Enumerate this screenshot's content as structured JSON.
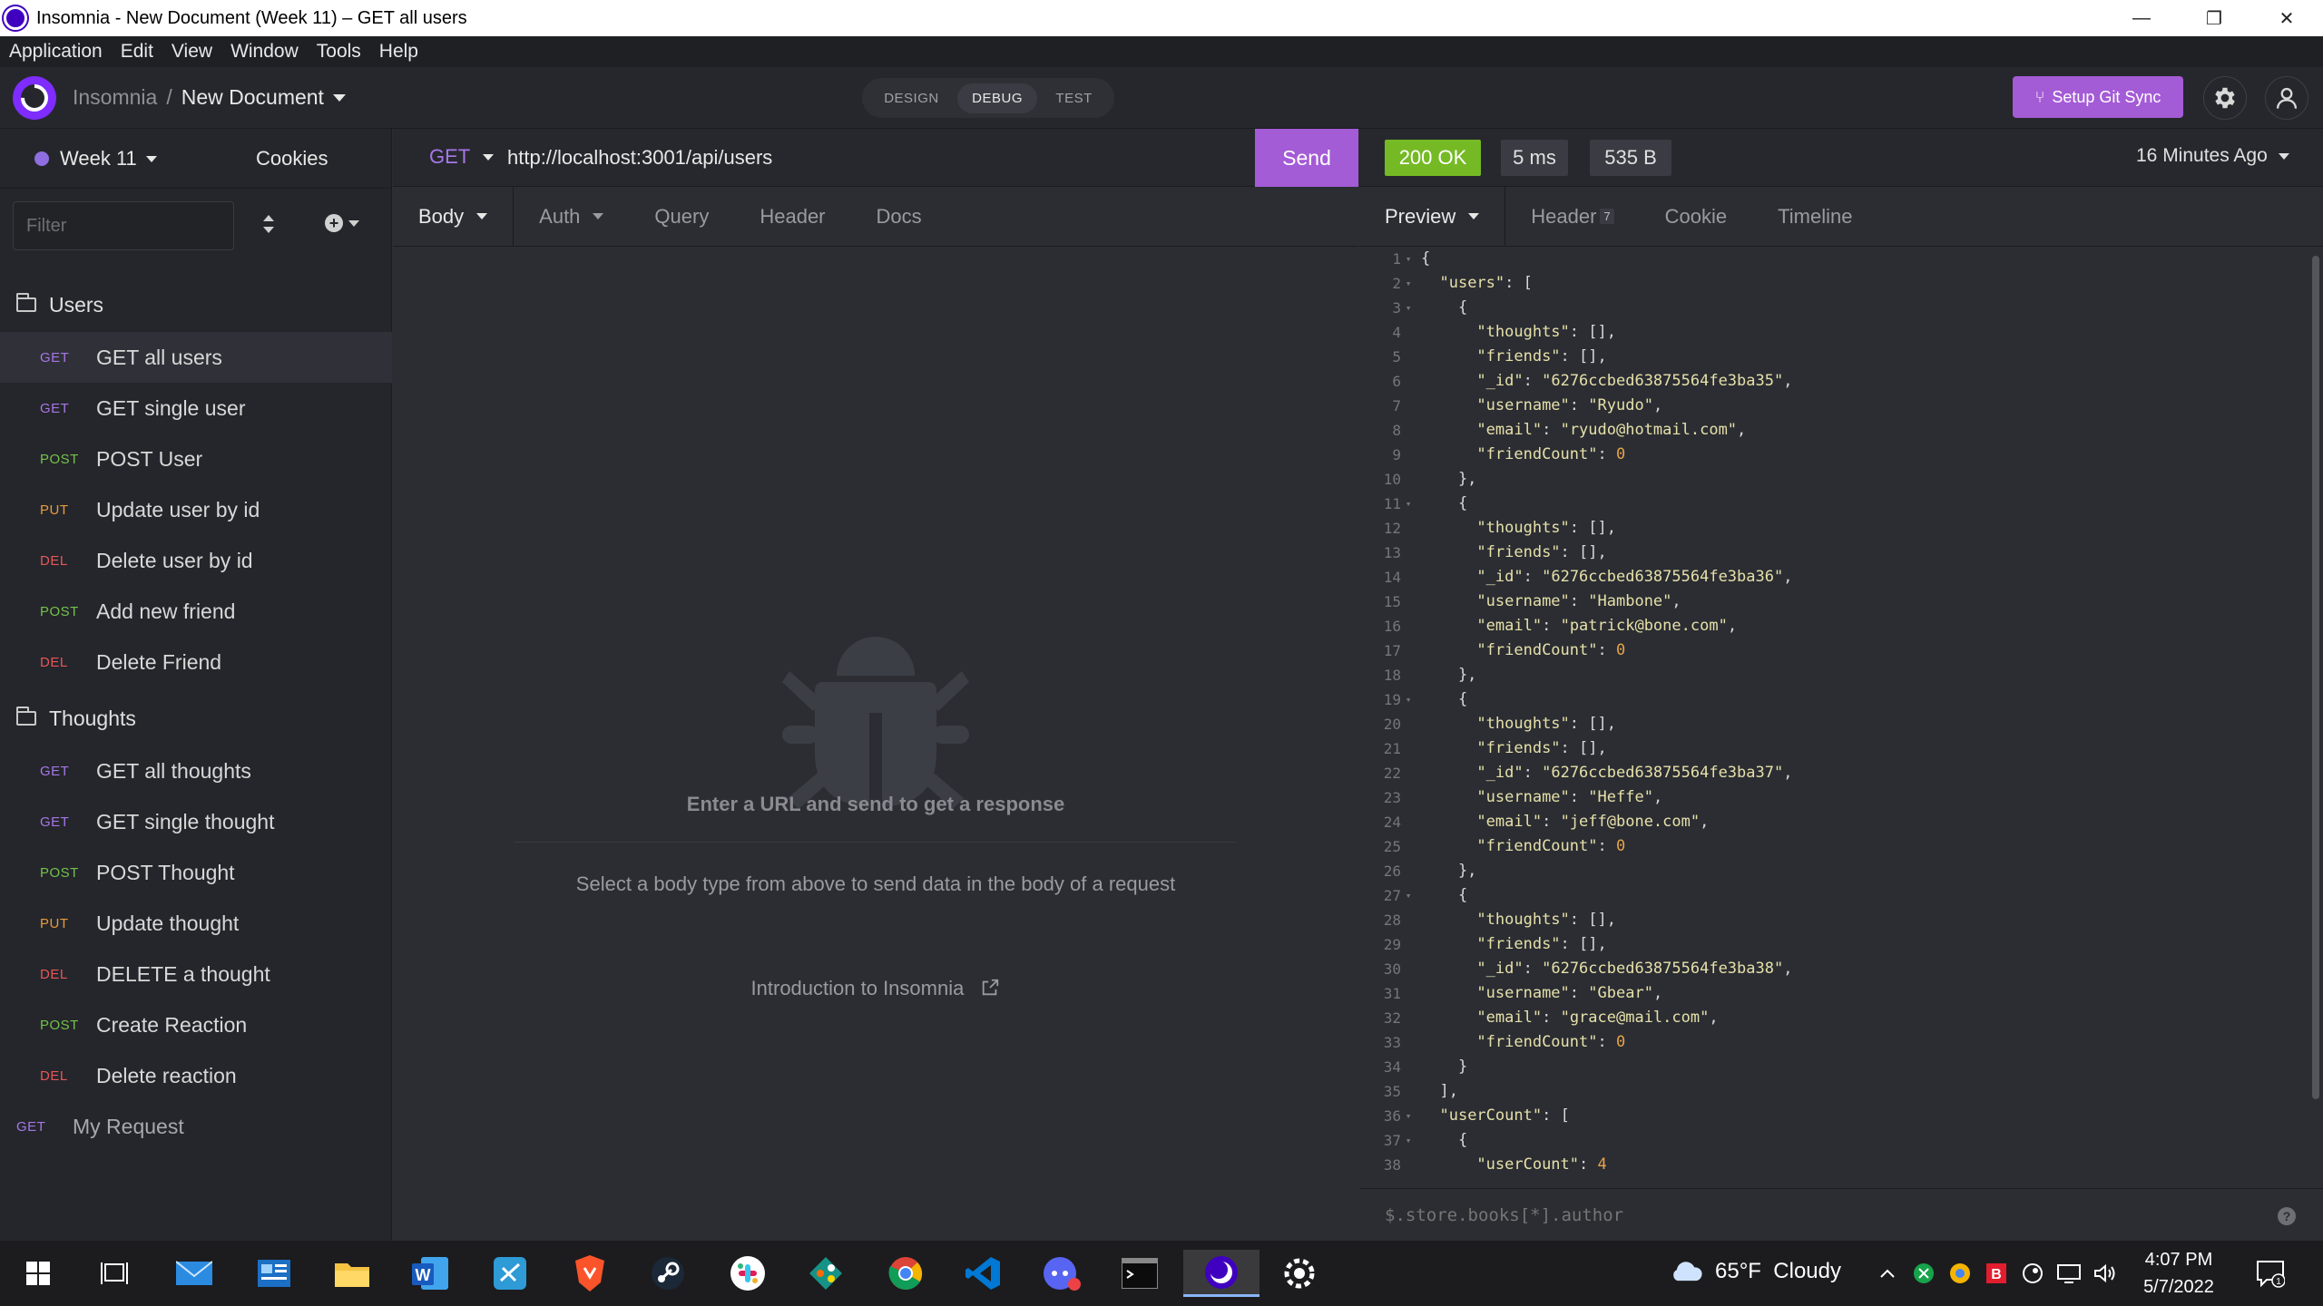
{
  "window": {
    "title": "Insomnia - New Document (Week 11) – GET all users",
    "minimize": "—",
    "maximize": "❐",
    "close": "✕"
  },
  "menu": [
    "Application",
    "Edit",
    "View",
    "Window",
    "Tools",
    "Help"
  ],
  "header": {
    "root": "Insomnia",
    "separator": "/",
    "document": "New Document",
    "modes": [
      "DESIGN",
      "DEBUG",
      "TEST"
    ],
    "active_mode": "DEBUG",
    "git_sync_label": "Setup Git Sync",
    "git_icon": "branch-icon"
  },
  "sidebar": {
    "workspace": "Week 11",
    "workspace_color": "#8e6ee0",
    "cookies": "Cookies",
    "filter_placeholder": "Filter",
    "folders": [
      {
        "name": "Users",
        "requests": [
          {
            "method": "GET",
            "name": "GET all users",
            "active": true
          },
          {
            "method": "GET",
            "name": "GET single user"
          },
          {
            "method": "POST",
            "name": "POST User"
          },
          {
            "method": "PUT",
            "name": "Update user by id"
          },
          {
            "method": "DEL",
            "name": "Delete user by id"
          },
          {
            "method": "POST",
            "name": "Add new friend"
          },
          {
            "method": "DEL",
            "name": "Delete Friend"
          }
        ]
      },
      {
        "name": "Thoughts",
        "requests": [
          {
            "method": "GET",
            "name": "GET all thoughts"
          },
          {
            "method": "GET",
            "name": "GET single thought"
          },
          {
            "method": "POST",
            "name": "POST Thought"
          },
          {
            "method": "PUT",
            "name": "Update thought"
          },
          {
            "method": "DEL",
            "name": "DELETE a thought"
          },
          {
            "method": "POST",
            "name": "Create Reaction"
          },
          {
            "method": "DEL",
            "name": "Delete reaction"
          }
        ]
      }
    ],
    "loose_request": {
      "method": "GET",
      "name": "My Request"
    },
    "method_colors": {
      "GET": "#a677e8",
      "POST": "#73c24a",
      "PUT": "#e89b3b",
      "DEL": "#e6575a"
    }
  },
  "request": {
    "method": "GET",
    "url": "http://localhost:3001/api/users",
    "send_label": "Send",
    "tabs": [
      "Body",
      "Auth",
      "Query",
      "Header",
      "Docs"
    ],
    "empty_title": "Enter a URL and send to get a response",
    "empty_hint": "Select a body type from above to send data in the body of a request",
    "intro_link": "Introduction to Insomnia"
  },
  "response": {
    "status": "200 OK",
    "status_color": "#75ba24",
    "time": "5 ms",
    "size": "535 B",
    "history": "16 Minutes Ago",
    "tabs": [
      "Preview",
      "Header",
      "Cookie",
      "Timeline"
    ],
    "header_count": "7",
    "filter_placeholder": "$.store.books[*].author",
    "help": "?",
    "lines": [
      {
        "n": "1",
        "f": "▾",
        "t": "{"
      },
      {
        "n": "2",
        "f": "▾",
        "t": "  \"users\": ["
      },
      {
        "n": "3",
        "f": "▾",
        "t": "    {"
      },
      {
        "n": "4",
        "f": "",
        "t": "      \"thoughts\": [],"
      },
      {
        "n": "5",
        "f": "",
        "t": "      \"friends\": [],"
      },
      {
        "n": "6",
        "f": "",
        "t": "      \"_id\": \"6276ccbed63875564fe3ba35\","
      },
      {
        "n": "7",
        "f": "",
        "t": "      \"username\": \"Ryudo\","
      },
      {
        "n": "8",
        "f": "",
        "t": "      \"email\": \"ryudo@hotmail.com\","
      },
      {
        "n": "9",
        "f": "",
        "t": "      \"friendCount\": 0"
      },
      {
        "n": "10",
        "f": "",
        "t": "    },"
      },
      {
        "n": "11",
        "f": "▾",
        "t": "    {"
      },
      {
        "n": "12",
        "f": "",
        "t": "      \"thoughts\": [],"
      },
      {
        "n": "13",
        "f": "",
        "t": "      \"friends\": [],"
      },
      {
        "n": "14",
        "f": "",
        "t": "      \"_id\": \"6276ccbed63875564fe3ba36\","
      },
      {
        "n": "15",
        "f": "",
        "t": "      \"username\": \"Hambone\","
      },
      {
        "n": "16",
        "f": "",
        "t": "      \"email\": \"patrick@bone.com\","
      },
      {
        "n": "17",
        "f": "",
        "t": "      \"friendCount\": 0"
      },
      {
        "n": "18",
        "f": "",
        "t": "    },"
      },
      {
        "n": "19",
        "f": "▾",
        "t": "    {"
      },
      {
        "n": "20",
        "f": "",
        "t": "      \"thoughts\": [],"
      },
      {
        "n": "21",
        "f": "",
        "t": "      \"friends\": [],"
      },
      {
        "n": "22",
        "f": "",
        "t": "      \"_id\": \"6276ccbed63875564fe3ba37\","
      },
      {
        "n": "23",
        "f": "",
        "t": "      \"username\": \"Heffe\","
      },
      {
        "n": "24",
        "f": "",
        "t": "      \"email\": \"jeff@bone.com\","
      },
      {
        "n": "25",
        "f": "",
        "t": "      \"friendCount\": 0"
      },
      {
        "n": "26",
        "f": "",
        "t": "    },"
      },
      {
        "n": "27",
        "f": "▾",
        "t": "    {"
      },
      {
        "n": "28",
        "f": "",
        "t": "      \"thoughts\": [],"
      },
      {
        "n": "29",
        "f": "",
        "t": "      \"friends\": [],"
      },
      {
        "n": "30",
        "f": "",
        "t": "      \"_id\": \"6276ccbed63875564fe3ba38\","
      },
      {
        "n": "31",
        "f": "",
        "t": "      \"username\": \"Gbear\","
      },
      {
        "n": "32",
        "f": "",
        "t": "      \"email\": \"grace@mail.com\","
      },
      {
        "n": "33",
        "f": "",
        "t": "      \"friendCount\": 0"
      },
      {
        "n": "34",
        "f": "",
        "t": "    }"
      },
      {
        "n": "35",
        "f": "",
        "t": "  ],"
      },
      {
        "n": "36",
        "f": "▾",
        "t": "  \"userCount\": ["
      },
      {
        "n": "37",
        "f": "▾",
        "t": "    {"
      },
      {
        "n": "38",
        "f": "",
        "t": "      \"userCount\": 4"
      }
    ]
  },
  "taskbar": {
    "apps": [
      "start-icon",
      "task-view-icon",
      "mail-icon",
      "news-icon",
      "file-explorer-icon",
      "word-icon",
      "edge-icon",
      "brave-icon",
      "steam-icon",
      "slack-icon",
      "git-kraken-icon",
      "chrome-icon",
      "vscode-icon",
      "discord-icon",
      "terminal-icon",
      "insomnia-icon",
      "settings-icon"
    ],
    "weather": "65°F  Cloudy",
    "time": "4:07 PM",
    "date": "5/7/2022"
  }
}
